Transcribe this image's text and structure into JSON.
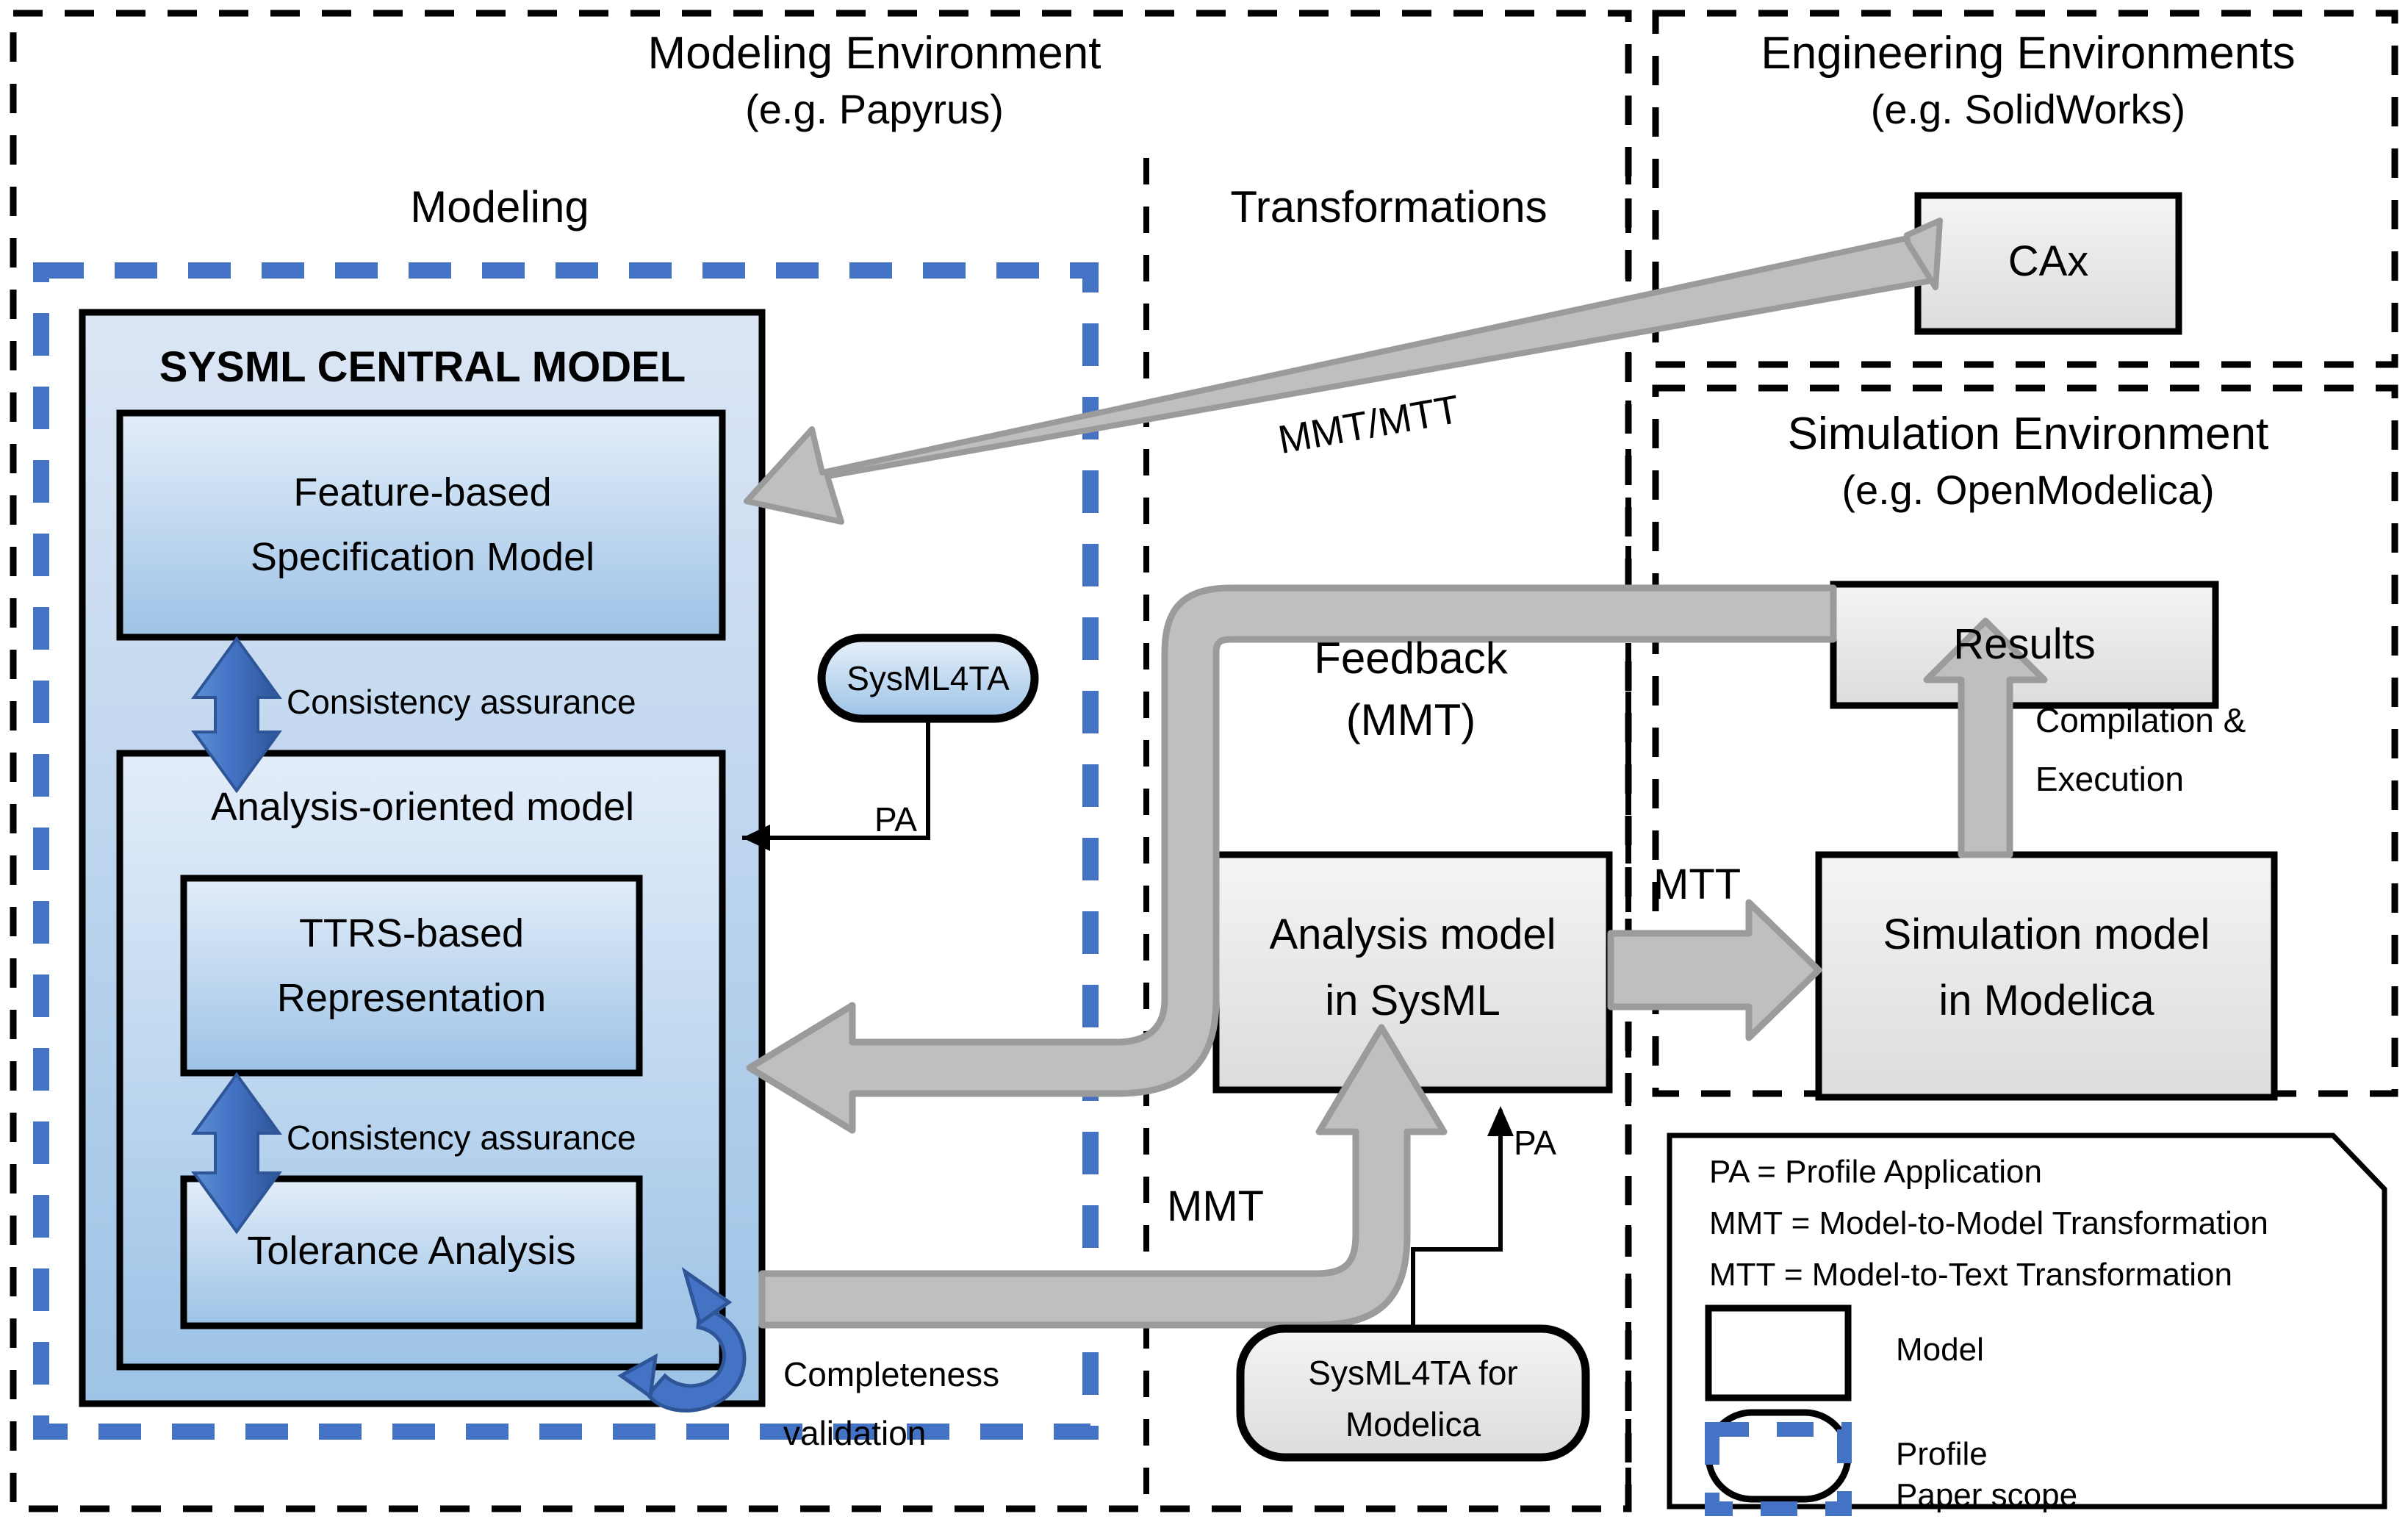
{
  "regions": {
    "modeling_environment": {
      "title": "Modeling Environment",
      "subtitle": "(e.g. Papyrus)"
    },
    "engineering_environments": {
      "title": "Engineering Environments",
      "subtitle": "(e.g. SolidWorks)"
    },
    "simulation_environment": {
      "title": "Simulation Environment",
      "subtitle": "(e.g. OpenModelica)"
    }
  },
  "columns": {
    "modeling": "Modeling",
    "transformations": "Transformations"
  },
  "central_model": {
    "title": "SYSML CENTRAL MODEL",
    "feature_spec_line1": "Feature-based",
    "feature_spec_line2": "Specification Model",
    "analysis_oriented": "Analysis-oriented model",
    "ttrs_line1": "TTRS-based",
    "ttrs_line2": "Representation",
    "tolerance_analysis": "Tolerance Analysis",
    "consistency_top": "Consistency assurance",
    "consistency_bottom": "Consistency assurance",
    "completeness_line1": "Completeness",
    "completeness_line2": "validation"
  },
  "profiles": {
    "sysml4ta": "SysML4TA",
    "sysml4ta_modelica_line1": "SysML4TA for",
    "sysml4ta_modelica_line2": "Modelica",
    "pa_label_left": "PA",
    "pa_label_middle": "PA"
  },
  "models": {
    "cax": "CAx",
    "results": "Results",
    "analysis_model_line1": "Analysis model",
    "analysis_model_line2": "in SysML",
    "simulation_model_line1": "Simulation model",
    "simulation_model_line2": "in Modelica"
  },
  "arrow_labels": {
    "mmt_mtt": "MMT/MTT",
    "feedback_line1": "Feedback",
    "feedback_line2": "(MMT)",
    "mmt": "MMT",
    "mtt": "MTT",
    "compilation_line1": "Compilation &",
    "compilation_line2": "Execution"
  },
  "legend": {
    "pa": "PA = Profile Application",
    "mmt": "MMT = Model-to-Model Transformation",
    "mtt": "MTT = Model-to-Text Transformation",
    "model": "Model",
    "profile": "Profile",
    "paper_scope": "Paper scope"
  },
  "colors": {
    "paper_scope_blue": "#4472C4",
    "central_light": "#DCE6F5",
    "central_mid": "#9DC3E6",
    "gray_arrow_fill": "#BFBFBF",
    "gray_arrow_stroke": "#808080",
    "model_box_light": "#F2F2F2",
    "model_box_dark": "#D9D9D9",
    "black": "#000000"
  }
}
